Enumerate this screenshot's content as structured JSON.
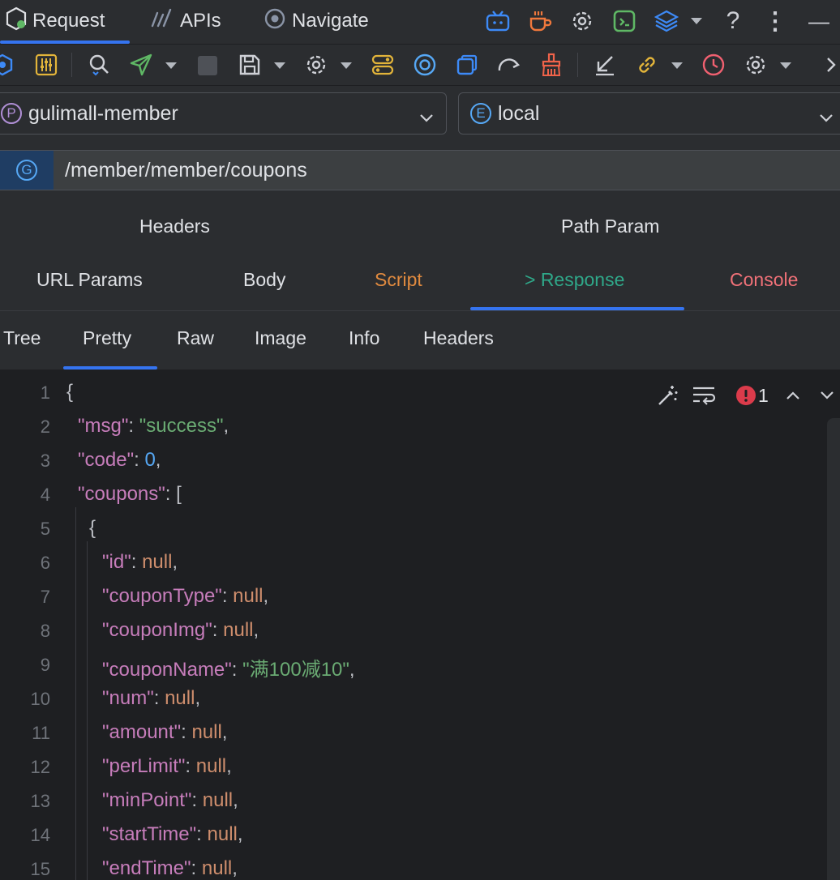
{
  "nav": {
    "tabs": [
      {
        "label": "Request"
      },
      {
        "label": "APIs"
      },
      {
        "label": "Navigate"
      }
    ],
    "help": "?",
    "more": "⋮",
    "minimize": "—"
  },
  "project_select": {
    "badge": "P",
    "value": "gulimall-member"
  },
  "env_select": {
    "badge": "E",
    "value": "local"
  },
  "request": {
    "method_badge": "G",
    "url": "/member/member/coupons"
  },
  "tabs_row1": [
    "Headers",
    "Path Param"
  ],
  "tabs_row2": [
    {
      "label": "URL Params",
      "color": "#dfe1e5"
    },
    {
      "label": "Body",
      "color": "#dfe1e5"
    },
    {
      "label": "Script",
      "color": "#e08a3f"
    },
    {
      "label": "> Response",
      "color": "#2fa889"
    },
    {
      "label": "Console",
      "color": "#f07178"
    }
  ],
  "response_tabs": [
    "Tree",
    "Pretty",
    "Raw",
    "Image",
    "Info",
    "Headers"
  ],
  "editor": {
    "problem_count": "1",
    "lines": [
      {
        "num": "1",
        "key": "",
        "val": "{",
        "vtype": "p",
        "tail": "",
        "indent": 0
      },
      {
        "num": "2",
        "key": "\"msg\"",
        "val": "\"success\"",
        "vtype": "s",
        "tail": ",",
        "indent": 1
      },
      {
        "num": "3",
        "key": "\"code\"",
        "val": "0",
        "vtype": "n",
        "tail": ",",
        "indent": 1
      },
      {
        "num": "4",
        "key": "\"coupons\"",
        "val": "[",
        "vtype": "p",
        "tail": "",
        "indent": 1
      },
      {
        "num": "5",
        "key": "",
        "val": "{",
        "vtype": "p",
        "tail": "",
        "indent": 2
      },
      {
        "num": "6",
        "key": "\"id\"",
        "val": "null",
        "vtype": "kw",
        "tail": ",",
        "indent": 3
      },
      {
        "num": "7",
        "key": "\"couponType\"",
        "val": "null",
        "vtype": "kw",
        "tail": ",",
        "indent": 3
      },
      {
        "num": "8",
        "key": "\"couponImg\"",
        "val": "null",
        "vtype": "kw",
        "tail": ",",
        "indent": 3
      },
      {
        "num": "9",
        "key": "\"couponName\"",
        "val": "\"满100减10\"",
        "vtype": "s",
        "tail": ",",
        "indent": 3
      },
      {
        "num": "10",
        "key": "\"num\"",
        "val": "null",
        "vtype": "kw",
        "tail": ",",
        "indent": 3
      },
      {
        "num": "11",
        "key": "\"amount\"",
        "val": "null",
        "vtype": "kw",
        "tail": ",",
        "indent": 3
      },
      {
        "num": "12",
        "key": "\"perLimit\"",
        "val": "null",
        "vtype": "kw",
        "tail": ",",
        "indent": 3
      },
      {
        "num": "13",
        "key": "\"minPoint\"",
        "val": "null",
        "vtype": "kw",
        "tail": ",",
        "indent": 3
      },
      {
        "num": "14",
        "key": "\"startTime\"",
        "val": "null",
        "vtype": "kw",
        "tail": ",",
        "indent": 3
      },
      {
        "num": "15",
        "key": "\"endTime\"",
        "val": "null",
        "vtype": "kw",
        "tail": ",",
        "indent": 3
      }
    ]
  },
  "colors": {
    "accent": "#3574f0",
    "string": "#6aab73",
    "key": "#c77dbb",
    "keyword": "#cf8e6d",
    "number": "#56a8f5"
  }
}
